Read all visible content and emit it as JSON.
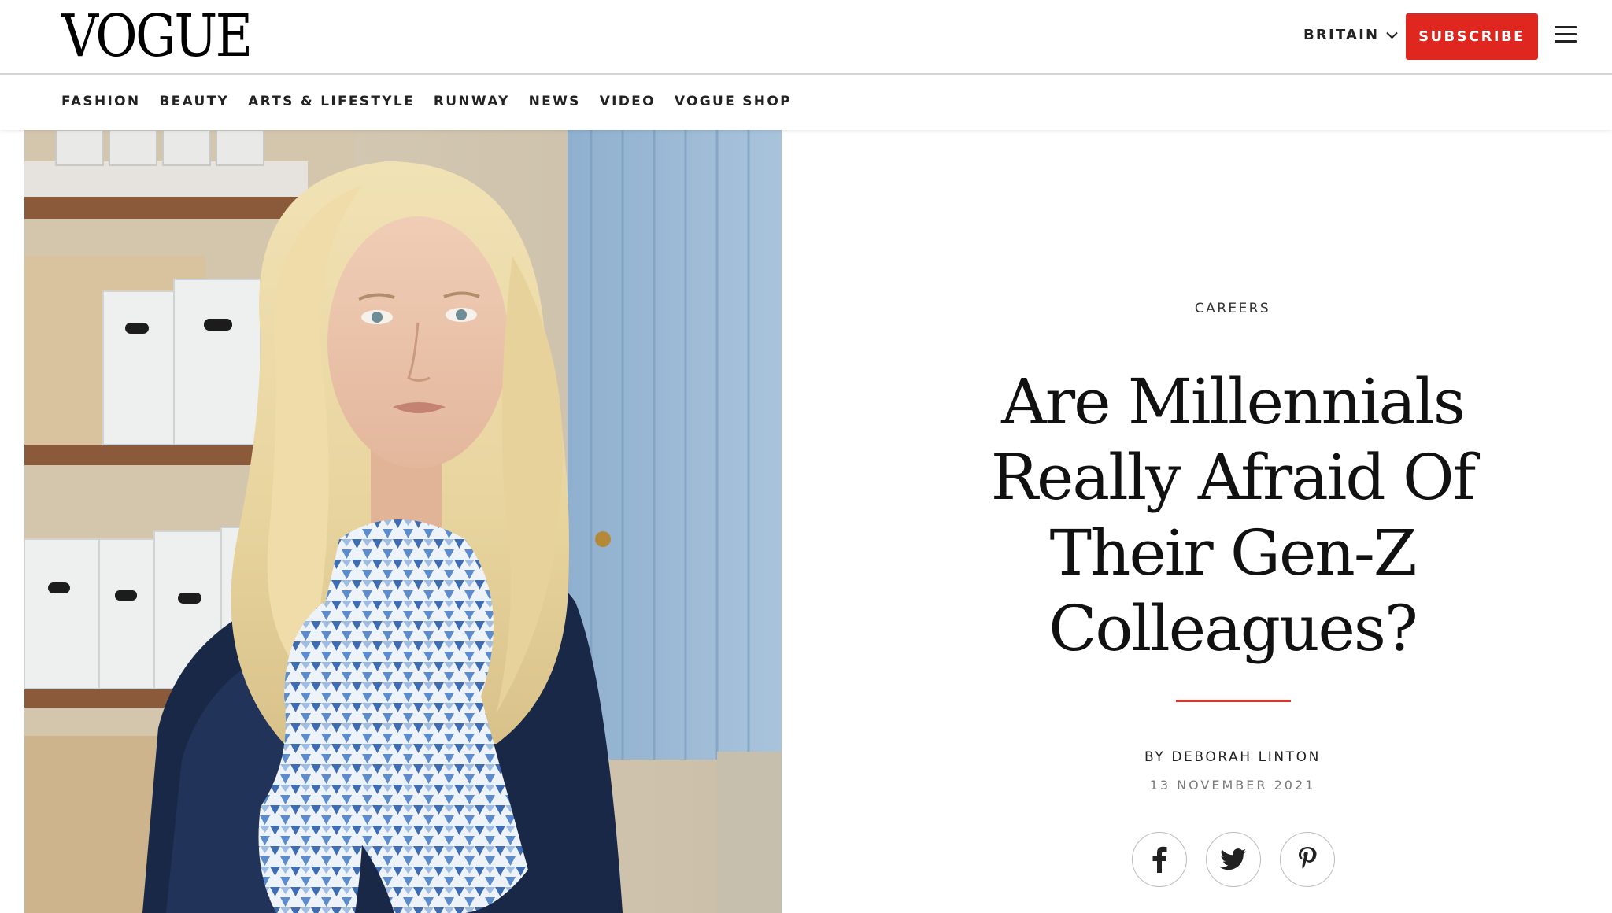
{
  "brand": {
    "name": "VOGUE"
  },
  "header": {
    "edition_label": "BRITAIN",
    "subscribe_label": "SUBSCRIBE",
    "menu_icon": "hamburger-menu-icon"
  },
  "nav": {
    "items": [
      {
        "label": "FASHION"
      },
      {
        "label": "BEAUTY"
      },
      {
        "label": "ARTS & LIFESTYLE"
      },
      {
        "label": "RUNWAY"
      },
      {
        "label": "NEWS"
      },
      {
        "label": "VIDEO"
      },
      {
        "label": "VOGUE SHOP"
      }
    ]
  },
  "article": {
    "rubric": "CAREERS",
    "headline": "Are Millennials Really Afraid Of Their Gen-Z Colleagues?",
    "byline_prefix": "BY",
    "author": "DEBORAH LINTON",
    "date": "13 NOVEMBER 2021",
    "share": [
      {
        "icon": "facebook-icon"
      },
      {
        "icon": "twitter-icon"
      },
      {
        "icon": "pinterest-icon"
      }
    ]
  },
  "colors": {
    "accent": "#e0271f",
    "divider": "#d6382b",
    "text": "#111111",
    "muted": "#7a7a7a"
  }
}
